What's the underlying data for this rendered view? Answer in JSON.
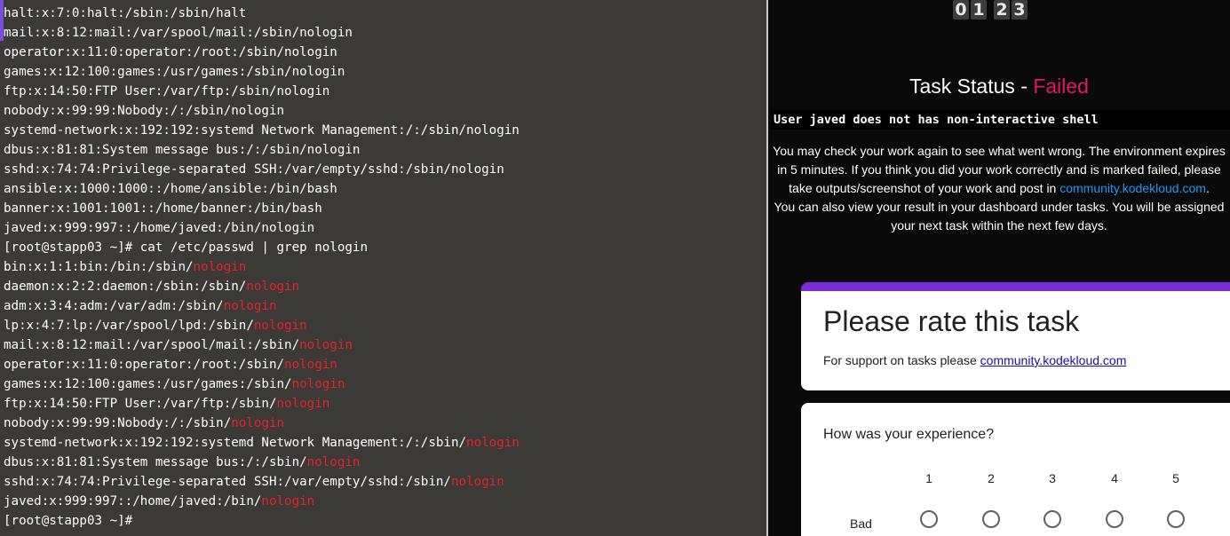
{
  "terminal": {
    "lines": [
      {
        "text": "halt:x:7:0:halt:/sbin:/sbin/halt",
        "hl": ""
      },
      {
        "text": "mail:x:8:12:mail:/var/spool/mail:/sbin/nologin",
        "hl": ""
      },
      {
        "text": "operator:x:11:0:operator:/root:/sbin/nologin",
        "hl": ""
      },
      {
        "text": "games:x:12:100:games:/usr/games:/sbin/nologin",
        "hl": ""
      },
      {
        "text": "ftp:x:14:50:FTP User:/var/ftp:/sbin/nologin",
        "hl": ""
      },
      {
        "text": "nobody:x:99:99:Nobody:/:/sbin/nologin",
        "hl": ""
      },
      {
        "text": "systemd-network:x:192:192:systemd Network Management:/:/sbin/nologin",
        "hl": ""
      },
      {
        "text": "dbus:x:81:81:System message bus:/:/sbin/nologin",
        "hl": ""
      },
      {
        "text": "sshd:x:74:74:Privilege-separated SSH:/var/empty/sshd:/sbin/nologin",
        "hl": ""
      },
      {
        "text": "ansible:x:1000:1000::/home/ansible:/bin/bash",
        "hl": ""
      },
      {
        "text": "banner:x:1001:1001::/home/banner:/bin/bash",
        "hl": ""
      },
      {
        "text": "javed:x:999:997::/home/javed:/bin/nologin",
        "hl": ""
      },
      {
        "text": "[root@stapp03 ~]# cat /etc/passwd | grep nologin",
        "hl": ""
      },
      {
        "text": "bin:x:1:1:bin:/bin:/sbin/",
        "hl": "nologin"
      },
      {
        "text": "daemon:x:2:2:daemon:/sbin:/sbin/",
        "hl": "nologin"
      },
      {
        "text": "adm:x:3:4:adm:/var/adm:/sbin/",
        "hl": "nologin"
      },
      {
        "text": "lp:x:4:7:lp:/var/spool/lpd:/sbin/",
        "hl": "nologin"
      },
      {
        "text": "mail:x:8:12:mail:/var/spool/mail:/sbin/",
        "hl": "nologin"
      },
      {
        "text": "operator:x:11:0:operator:/root:/sbin/",
        "hl": "nologin"
      },
      {
        "text": "games:x:12:100:games:/usr/games:/sbin/",
        "hl": "nologin"
      },
      {
        "text": "ftp:x:14:50:FTP User:/var/ftp:/sbin/",
        "hl": "nologin"
      },
      {
        "text": "nobody:x:99:99:Nobody:/:/sbin/",
        "hl": "nologin"
      },
      {
        "text": "systemd-network:x:192:192:systemd Network Management:/:/sbin/",
        "hl": "nologin"
      },
      {
        "text": "dbus:x:81:81:System message bus:/:/sbin/",
        "hl": "nologin"
      },
      {
        "text": "sshd:x:74:74:Privilege-separated SSH:/var/empty/sshd:/sbin/",
        "hl": "nologin"
      },
      {
        "text": "javed:x:999:997::/home/javed:/bin/",
        "hl": "nologin"
      },
      {
        "text": "[root@stapp03 ~]#",
        "hl": ""
      }
    ]
  },
  "timer": {
    "d1": "0",
    "d2": "1",
    "d3": "2",
    "d4": "3"
  },
  "task": {
    "status_prefix": "Task Status - ",
    "status_value": "Failed",
    "status_message": "User javed does not has non-interactive shell",
    "info_text_1": "You may check your work again to see what went wrong. The environment expires in 5 minutes. If you think you did your work correctly and is marked failed, please take outputs/screenshot of your work and post in ",
    "info_link": "community.kodekloud.com",
    "info_text_2": ".",
    "info_text_3": "You can also view your result in your dashboard under tasks. You will be assigned your next task within the next few days."
  },
  "rating": {
    "title": "Please rate this task",
    "support_prefix": "For support on tasks please ",
    "support_link": "community.kodekloud.com",
    "question": "How was your experience?",
    "scale": [
      "1",
      "2",
      "3",
      "4",
      "5"
    ],
    "low_label": "Bad"
  },
  "colors": {
    "terminal_bg": "#3b3a37",
    "highlight": "#e8222a",
    "failed": "#e8175d",
    "link": "#2196f3",
    "card_accent": "#7a2cd6"
  }
}
